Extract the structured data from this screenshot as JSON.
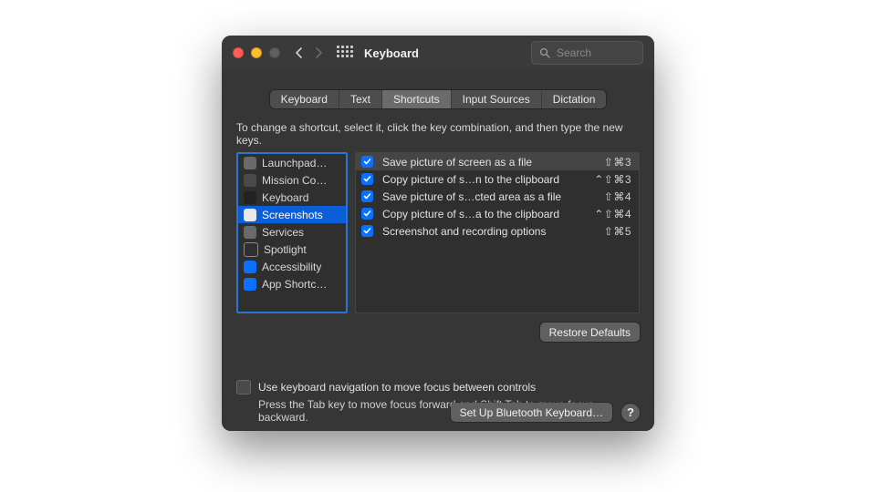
{
  "window": {
    "title": "Keyboard"
  },
  "search": {
    "placeholder": "Search"
  },
  "tabs": [
    {
      "label": "Keyboard"
    },
    {
      "label": "Text"
    },
    {
      "label": "Shortcuts",
      "active": true
    },
    {
      "label": "Input Sources"
    },
    {
      "label": "Dictation"
    }
  ],
  "instruction": "To change a shortcut, select it, click the key combination, and then type the new keys.",
  "categories": [
    {
      "label": "Launchpad…",
      "icon": "ic-gray"
    },
    {
      "label": "Mission Co…",
      "icon": "ic-dark"
    },
    {
      "label": "Keyboard",
      "icon": "ic-black"
    },
    {
      "label": "Screenshots",
      "icon": "ic-white",
      "selected": true
    },
    {
      "label": "Services",
      "icon": "ic-gear"
    },
    {
      "label": "Spotlight",
      "icon": "ic-circ"
    },
    {
      "label": "Accessibility",
      "icon": "ic-blue"
    },
    {
      "label": "App Shortc…",
      "icon": "ic-blue"
    }
  ],
  "shortcuts": [
    {
      "label": "Save picture of screen as a file",
      "keys": "⇧⌘3",
      "selected": true
    },
    {
      "label": "Copy picture of s…n to the clipboard",
      "keys": "⌃⇧⌘3"
    },
    {
      "label": "Save picture of s…cted area as a file",
      "keys": "⇧⌘4"
    },
    {
      "label": "Copy picture of s…a to the clipboard",
      "keys": "⌃⇧⌘4"
    },
    {
      "label": "Screenshot and recording options",
      "keys": "⇧⌘5"
    }
  ],
  "buttons": {
    "restore": "Restore Defaults",
    "bluetooth": "Set Up Bluetooth Keyboard…"
  },
  "kbnav": {
    "line1": "Use keyboard navigation to move focus between controls",
    "line2": "Press the Tab key to move focus forward and Shift Tab to move focus backward."
  }
}
